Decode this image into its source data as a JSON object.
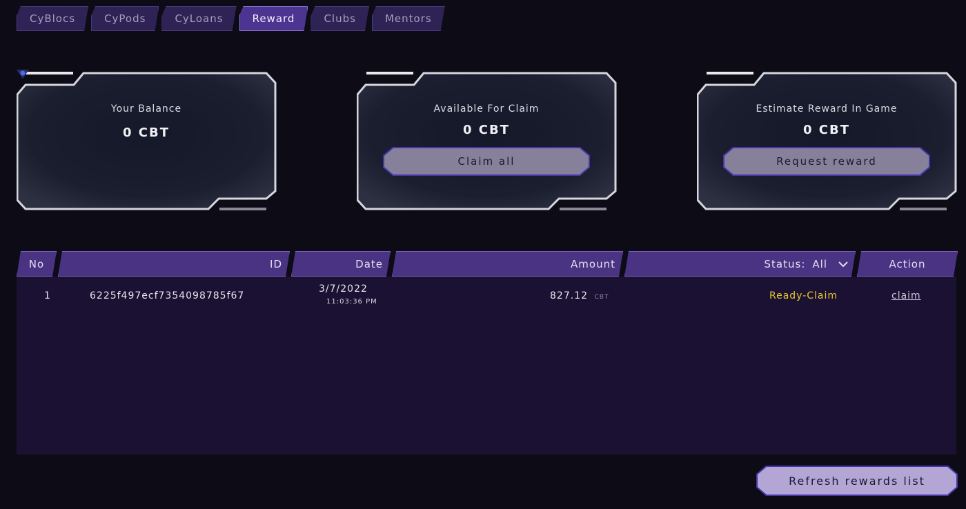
{
  "nav": {
    "tabs": [
      {
        "label": "CyBlocs",
        "active": false
      },
      {
        "label": "CyPods",
        "active": false
      },
      {
        "label": "CyLoans",
        "active": false
      },
      {
        "label": "Reward",
        "active": true
      },
      {
        "label": "Clubs",
        "active": false
      },
      {
        "label": "Mentors",
        "active": false
      }
    ]
  },
  "cards": {
    "balance": {
      "icon": "token-icon",
      "label": "Your Balance",
      "value": "0 CBT"
    },
    "claim": {
      "label": "Available For Claim",
      "value": "0 CBT",
      "button": "Claim all"
    },
    "estimate": {
      "label": "Estimate Reward In Game",
      "value": "0 CBT",
      "button": "Request reward"
    }
  },
  "table": {
    "headers": {
      "no": "No",
      "id": "ID",
      "date": "Date",
      "amount": "Amount",
      "status_label": "Status:",
      "status_value": "All",
      "action": "Action"
    },
    "rows": [
      {
        "no": "1",
        "id": "6225f497ecf7354098785f67",
        "date": "3/7/2022",
        "time": "11:03:36 PM",
        "amount": "827.12",
        "unit": "CBT",
        "status": "Ready-Claim",
        "action": "claim"
      }
    ]
  },
  "refresh_button": "Refresh rewards list",
  "colors": {
    "background": "#0d0b16",
    "accent": "#4a3382",
    "status_ready": "#e8c62a",
    "table_bg": "#1b1233"
  }
}
